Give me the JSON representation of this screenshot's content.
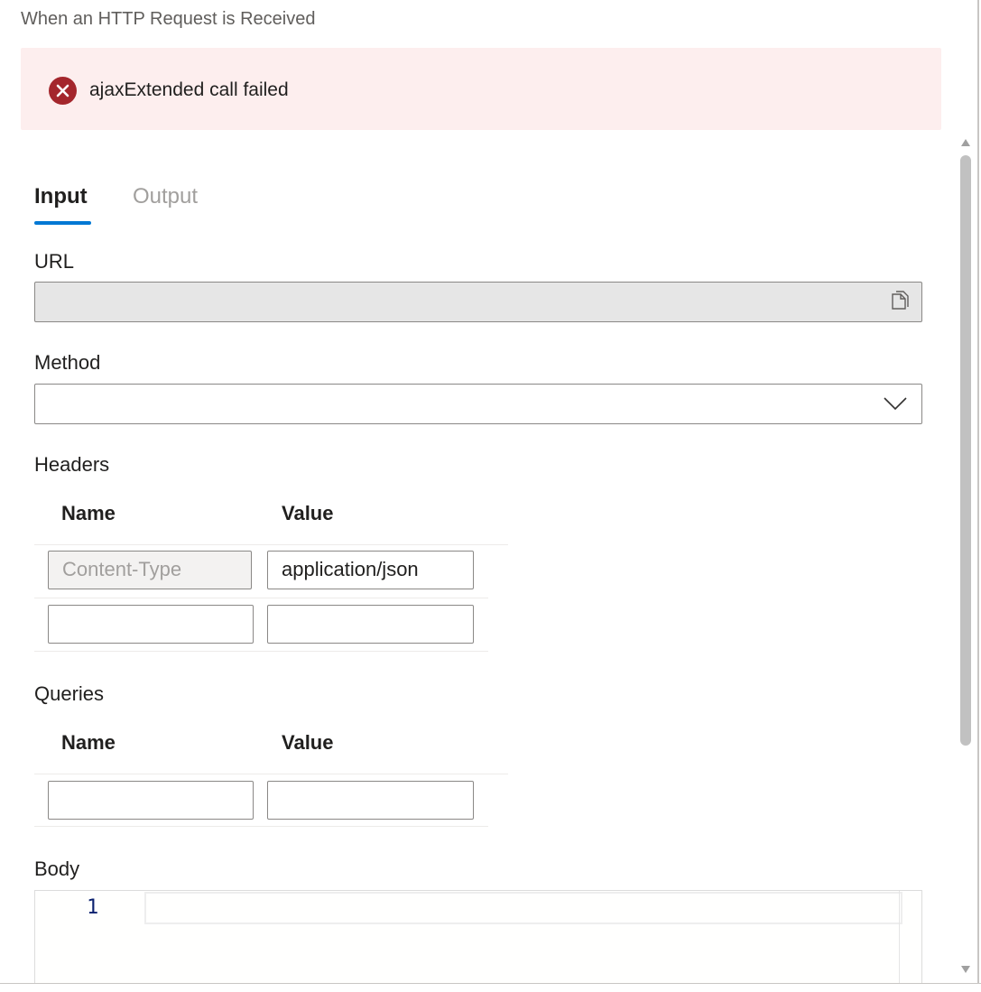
{
  "header": {
    "subtitle": "When an HTTP Request is Received"
  },
  "error": {
    "message": "ajaxExtended call failed",
    "icon": "error-circle-icon",
    "color": "#a4262c",
    "background": "#fdeeee"
  },
  "tabs": [
    {
      "label": "Input",
      "selected": true
    },
    {
      "label": "Output",
      "selected": false
    }
  ],
  "accent_color": "#0078d4",
  "url": {
    "label": "URL",
    "value": "",
    "icon": "copy-icon"
  },
  "method": {
    "label": "Method",
    "value": "",
    "icon": "chevron-down-icon"
  },
  "headers": {
    "label": "Headers",
    "columns": [
      "Name",
      "Value"
    ],
    "rows": [
      {
        "name": "",
        "name_placeholder": "Content-Type",
        "value": "application/json"
      },
      {
        "name": "",
        "name_placeholder": "",
        "value": ""
      }
    ]
  },
  "queries": {
    "label": "Queries",
    "columns": [
      "Name",
      "Value"
    ],
    "rows": [
      {
        "name": "",
        "value": ""
      }
    ]
  },
  "body": {
    "label": "Body",
    "line_numbers": [
      "1"
    ],
    "content": ""
  }
}
